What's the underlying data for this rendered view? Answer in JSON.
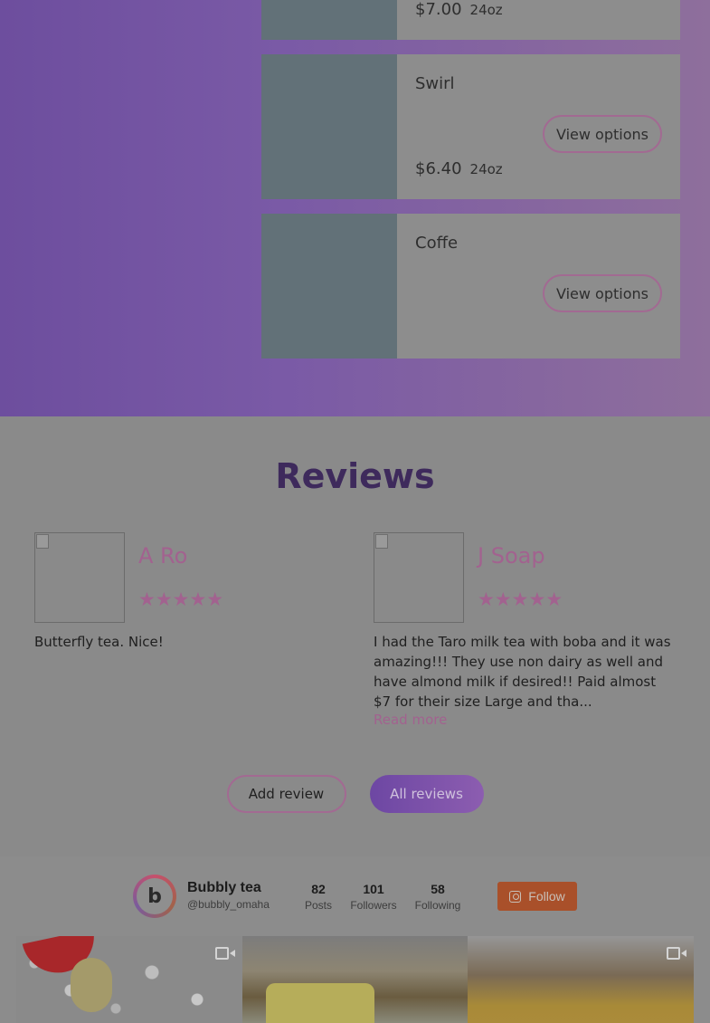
{
  "menu": {
    "items": [
      {
        "name": "",
        "button": "",
        "price": "$7.00",
        "size": "24oz"
      },
      {
        "name": "Swirl",
        "button": "View options",
        "price": "$6.40",
        "size": "24oz"
      },
      {
        "name": "Coffe",
        "button": "View options",
        "price": "",
        "size": ""
      }
    ]
  },
  "reviews": {
    "title": "Reviews",
    "items": [
      {
        "name": "A Ro",
        "rating": 5,
        "stars": "★★★★★",
        "text": "Butterfly tea. Nice!",
        "read_more": ""
      },
      {
        "name": "J Soap",
        "rating": 5,
        "stars": "★★★★★",
        "text": "I had the Taro milk tea with boba and it was amazing!!! They use non dairy as well and have almond milk if desired!! Paid almost $7 for their size Large and tha...",
        "read_more": "Read more"
      }
    ],
    "add_review_label": "Add review",
    "all_reviews_label": "All reviews"
  },
  "instagram": {
    "logo_letter": "b",
    "name": "Bubbly tea",
    "handle": "@bubbly_omaha",
    "stats": [
      {
        "value": "82",
        "label": "Posts"
      },
      {
        "value": "101",
        "label": "Followers"
      },
      {
        "value": "58",
        "label": "Following"
      }
    ],
    "follow_label": "Follow",
    "follow_icon": "instagram-icon",
    "thumbnails": [
      {
        "type": "video",
        "icon": "video-icon"
      },
      {
        "type": "image",
        "icon": ""
      },
      {
        "type": "video",
        "icon": "video-icon"
      }
    ]
  },
  "colors": {
    "accent": "#a2628f",
    "gradient_start": "#6d4e9e",
    "gradient_end": "#8e6f9c",
    "follow_button": "#a9502a"
  }
}
